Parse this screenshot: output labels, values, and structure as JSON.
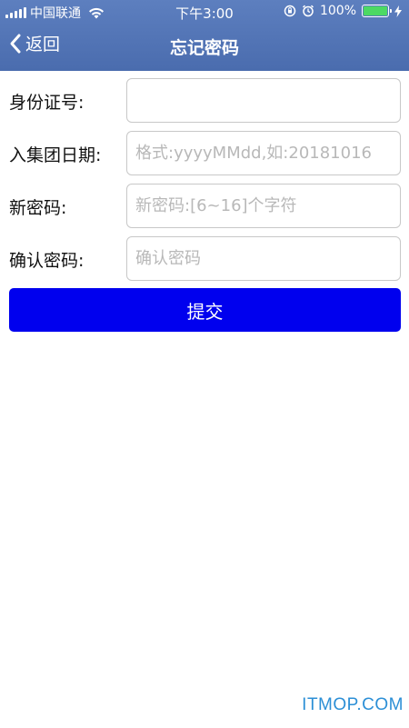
{
  "status_bar": {
    "carrier": "中国联通",
    "time": "下午3:00",
    "battery_percent": "100%",
    "battery_level": 1.0,
    "battery_color": "#4cd964"
  },
  "nav": {
    "back_label": "返回",
    "title": "忘记密码"
  },
  "form": {
    "id_number": {
      "label": "身份证号:",
      "value": "",
      "placeholder": ""
    },
    "join_date": {
      "label": "入集团日期:",
      "value": "",
      "placeholder": "格式:yyyyMMdd,如:20181016"
    },
    "new_password": {
      "label": "新密码:",
      "value": "",
      "placeholder": "新密码:[6~16]个字符"
    },
    "confirm_password": {
      "label": "确认密码:",
      "value": "",
      "placeholder": "确认密码"
    }
  },
  "submit_label": "提交",
  "watermark": "ITMOP.COM",
  "colors": {
    "header": "#4f71b3",
    "submit_button": "#0000ee",
    "watermark": "#2c8fd6"
  },
  "icons": {
    "signal": "signal-bars-icon",
    "wifi": "wifi-icon",
    "orientation_lock": "orientation-lock-icon",
    "alarm": "alarm-icon",
    "battery": "battery-icon",
    "charging": "charging-bolt-icon",
    "back": "chevron-left-icon"
  }
}
